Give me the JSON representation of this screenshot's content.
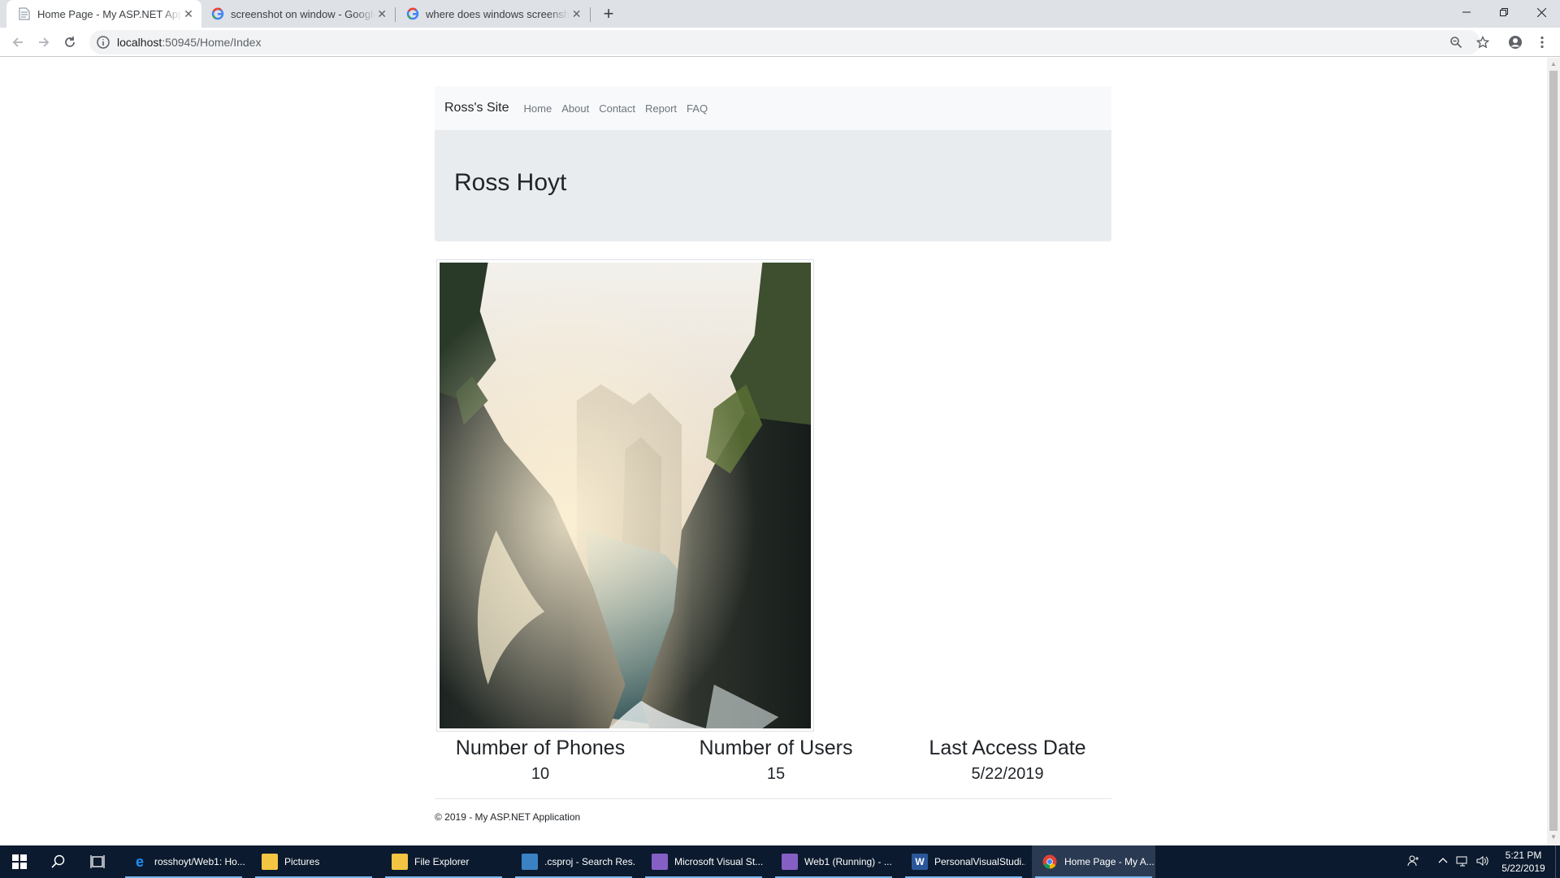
{
  "browser": {
    "tabs": [
      {
        "title": "Home Page - My ASP.NET Application",
        "active": true,
        "favicon": "document-icon"
      },
      {
        "title": "screenshot on window - Google Search",
        "active": false,
        "favicon": "google-icon"
      },
      {
        "title": "where does windows screenshots go",
        "active": false,
        "favicon": "google-icon"
      }
    ],
    "url_host": "localhost",
    "url_path": ":50945/Home/Index"
  },
  "site": {
    "brand": "Ross's Site",
    "nav": [
      "Home",
      "About",
      "Contact",
      "Report",
      "FAQ"
    ],
    "jumbotron_title": "Ross Hoyt",
    "stats": [
      {
        "label": "Number of Phones",
        "value": "10"
      },
      {
        "label": "Number of Users",
        "value": "15"
      },
      {
        "label": "Last Access Date",
        "value": "5/22/2019"
      }
    ],
    "footer": "© 2019 - My ASP.NET Application"
  },
  "taskbar": {
    "items": [
      {
        "label": "rosshoyt/Web1: Ho...",
        "icon": "edge-icon",
        "color": "#1e90ff"
      },
      {
        "label": "Pictures",
        "icon": "folder-icon",
        "color": "#f4c542"
      },
      {
        "label": "File Explorer",
        "icon": "folder-icon",
        "color": "#f4c542"
      },
      {
        "label": ".csproj - Search Res...",
        "icon": "search-results-icon",
        "color": "#3b82c4"
      },
      {
        "label": "Microsoft Visual St...",
        "icon": "visual-studio-icon",
        "color": "#865fc5"
      },
      {
        "label": "Web1 (Running) - ...",
        "icon": "visual-studio-icon",
        "color": "#865fc5"
      },
      {
        "label": "PersonalVisualStudi...",
        "icon": "word-icon",
        "color": "#2b579a"
      },
      {
        "label": "Home Page - My A...",
        "icon": "chrome-icon",
        "color": "#4285f4"
      }
    ],
    "time": "5:21 PM",
    "date": "5/22/2019"
  }
}
